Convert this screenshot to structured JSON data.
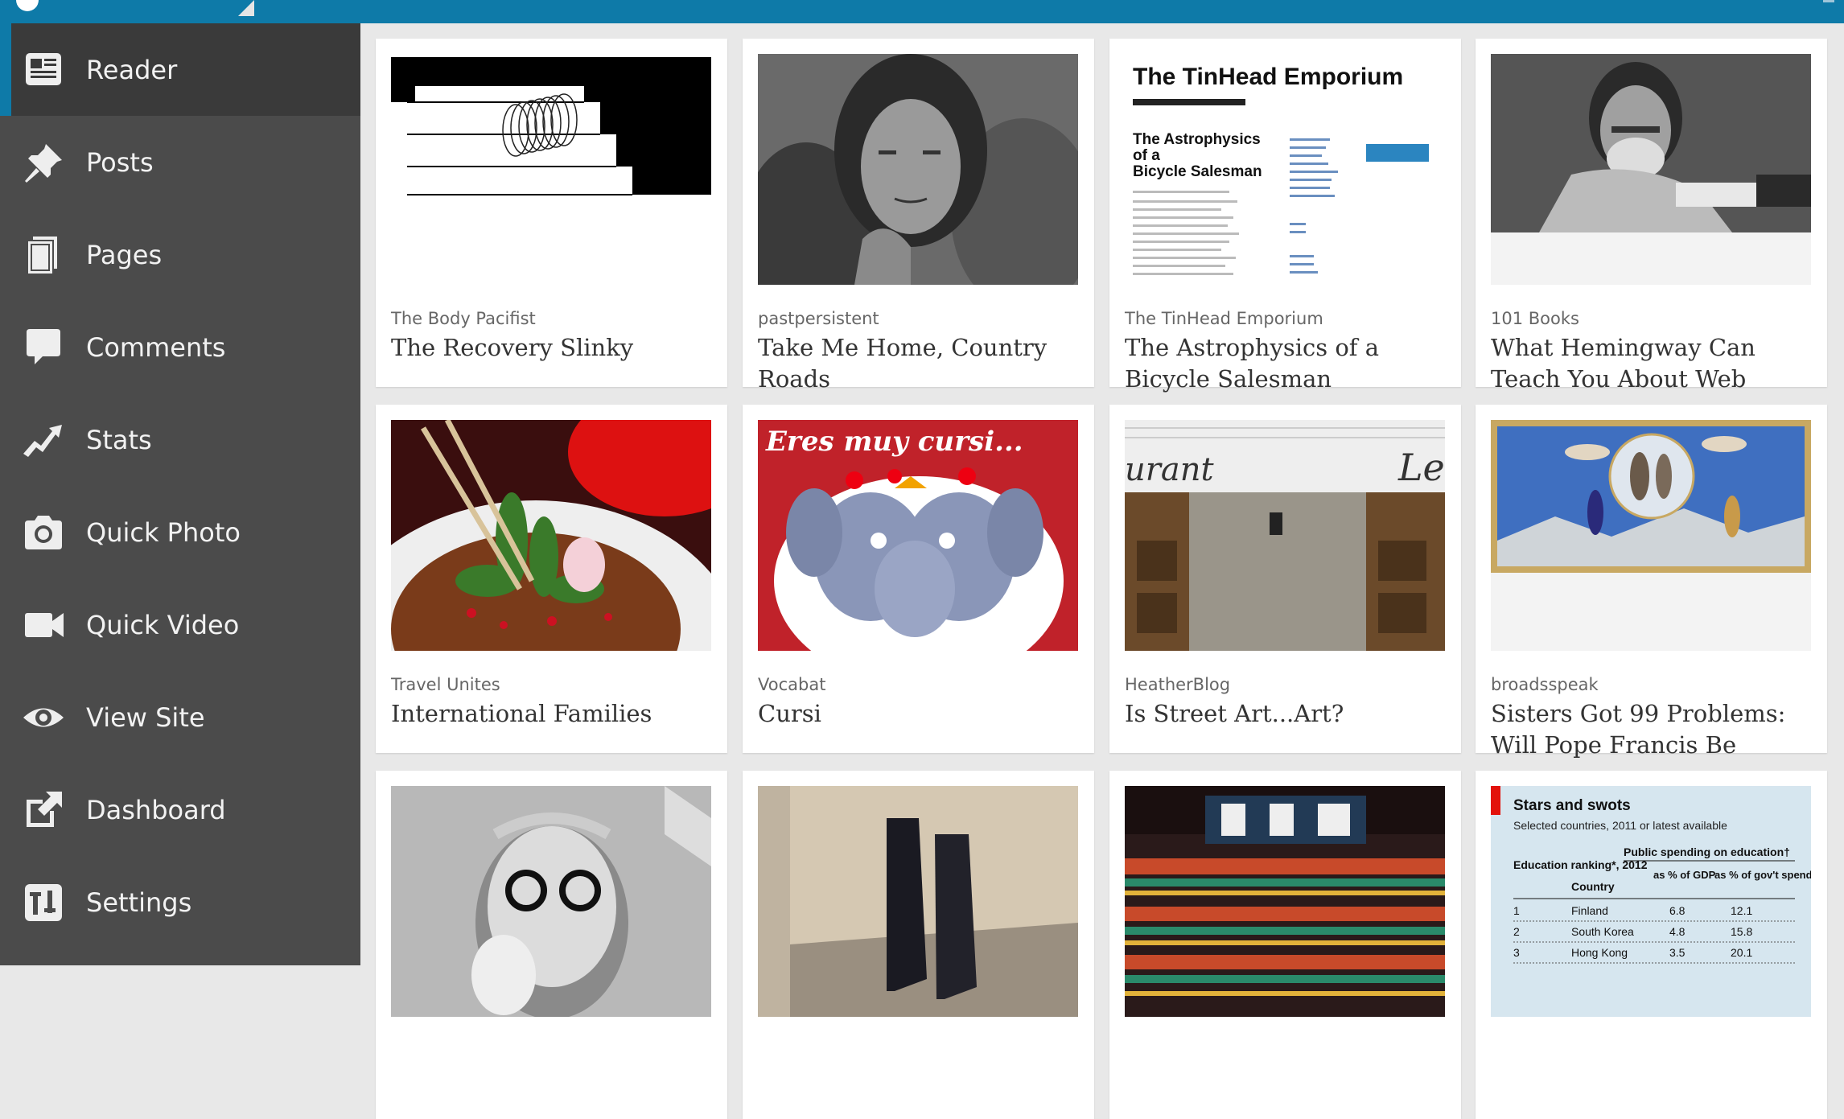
{
  "sidebar": {
    "items": [
      {
        "label": "Reader",
        "icon": "reader-icon"
      },
      {
        "label": "Posts",
        "icon": "pushpin-icon"
      },
      {
        "label": "Pages",
        "icon": "pages-icon"
      },
      {
        "label": "Comments",
        "icon": "comment-icon"
      },
      {
        "label": "Stats",
        "icon": "stats-icon"
      },
      {
        "label": "Quick Photo",
        "icon": "camera-icon"
      },
      {
        "label": "Quick Video",
        "icon": "video-camera-icon"
      },
      {
        "label": "View Site",
        "icon": "eye-icon"
      },
      {
        "label": "Dashboard",
        "icon": "external-link-icon"
      },
      {
        "label": "Settings",
        "icon": "settings-icon"
      }
    ]
  },
  "cards": [
    {
      "source": "The Body Pacifist",
      "title": "The Recovery Slinky"
    },
    {
      "source": "pastpersistent",
      "title": "Take Me Home, Country Roads"
    },
    {
      "source": "The TinHead Emporium",
      "title": "The Astrophysics of a Bicycle Salesman"
    },
    {
      "source": "101 Books",
      "title": "What Hemingway Can Teach You About Web"
    },
    {
      "source": "Travel Unites",
      "title": "International Families"
    },
    {
      "source": "Vocabat",
      "title": "Cursi"
    },
    {
      "source": "HeatherBlog",
      "title": "Is Street Art...Art?"
    },
    {
      "source": "broadsspeak",
      "title": "Sisters Got 99 Problems: Will Pope Francis Be"
    },
    {
      "source": "",
      "title": ""
    },
    {
      "source": "",
      "title": ""
    },
    {
      "source": "",
      "title": ""
    },
    {
      "source": "",
      "title": ""
    }
  ],
  "thumbs": {
    "tinhead": {
      "header": "The TinHead Emporium",
      "post_title_1": "The Astrophysics",
      "post_title_2": "of a",
      "post_title_3": "Bicycle Salesman"
    },
    "vocabat": {
      "caption": "Eres muy cursi..."
    },
    "street": {
      "sign_left": "urant",
      "sign_right": "Le"
    },
    "economist": {
      "title": "Stars and swots",
      "subtitle": "Selected countries, 2011 or latest available",
      "col_rank": "Education ranking*, 2012",
      "col_country": "Country",
      "col_group": "Public spending on education†",
      "col_gdp": "as % of GDP",
      "col_gov": "as % of gov't spending",
      "rows": [
        {
          "rank": "1",
          "country": "Finland",
          "gdp": "6.8",
          "gov": "12.1"
        },
        {
          "rank": "2",
          "country": "South Korea",
          "gdp": "4.8",
          "gov": "15.8"
        },
        {
          "rank": "3",
          "country": "Hong Kong",
          "gdp": "3.5",
          "gov": "20.1"
        }
      ]
    }
  },
  "colors": {
    "topbar": "#0e7aa8",
    "sidebar": "#4b4b4b",
    "active": "#3a3a3a",
    "background": "#e8e8e8"
  }
}
